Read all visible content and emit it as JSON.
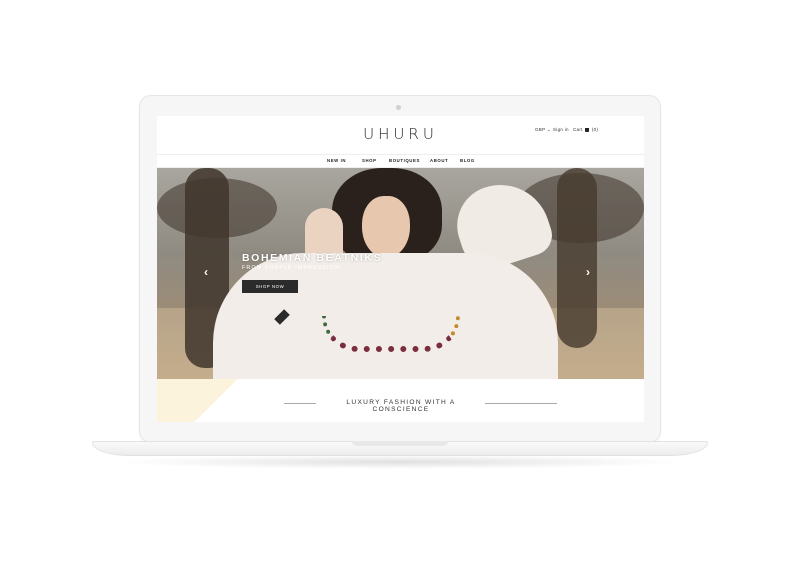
{
  "header": {
    "logo": "UHURU",
    "currency": "GBP ⌄",
    "sign_in": "Sign in",
    "cart_label": "Cart",
    "cart_count": "(0)"
  },
  "nav": {
    "items": [
      {
        "label": "NEW IN"
      },
      {
        "label": "SHOP"
      },
      {
        "label": "BOUTIQUES"
      },
      {
        "label": "ABOUT"
      },
      {
        "label": "BLOG"
      }
    ]
  },
  "hero": {
    "title": "BOHEMIAN BEATNIKS",
    "subtitle": "FROM PURPLE IMPRESSION",
    "cta_label": "SHOP NOW",
    "prev_arrow": "‹",
    "next_arrow": "›"
  },
  "tagline": "LUXURY FASHION WITH A CONSCIENCE",
  "colors": {
    "button_bg": "#2b2b2b",
    "accent_cream": "#fbf3dc",
    "text_dark": "#222222"
  }
}
